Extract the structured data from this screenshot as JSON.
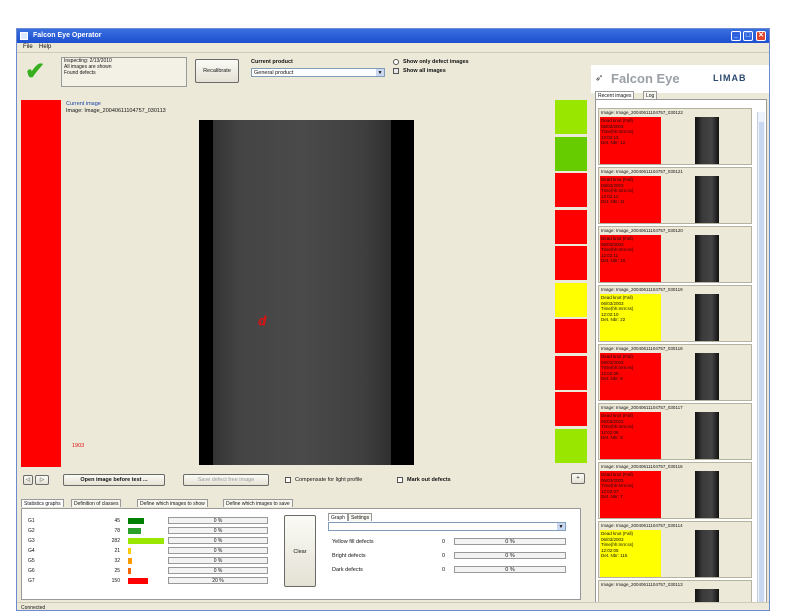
{
  "window": {
    "title": "Falcon Eye Operator"
  },
  "menu": [
    "File",
    "Help"
  ],
  "status": {
    "lines": [
      "Inspecting: 2/13/2010",
      "All images are shown",
      "Found defects"
    ]
  },
  "recalibrate_label": "Recalibrate",
  "current_product": {
    "label": "Current product",
    "value": "General product"
  },
  "view_options": [
    {
      "label": "Show only defect images",
      "selected": false
    },
    {
      "label": "Show all images",
      "selected": true
    }
  ],
  "logo": {
    "brand": "Falcon Eye",
    "company": "LIMAB"
  },
  "current_image": {
    "heading": "Current image",
    "name": "Image:   Image_20040611104757_030113",
    "counter": "1903"
  },
  "result_colors": [
    "#99e600",
    "#66cc00",
    "#ff0000",
    "#ff0000",
    "#ff0000",
    "#ffff00",
    "#ff0000",
    "#ff0000",
    "#ff0000",
    "#99e600"
  ],
  "controls": {
    "open_image_label": "Open image before test ...",
    "save_defect_label": "Save defect free image",
    "compensate_label": "Compensate for light profile",
    "mark_defects_label": "Mark out defects",
    "plus_label": "+"
  },
  "right_panel": {
    "tabs": [
      "Recent images",
      "Log"
    ],
    "thumbnails": [
      {
        "title": "Image:   Image_20040611104757_030122",
        "info": [
          "Dead knot (Fall)",
          "06/03/2003",
          "Time(hh:mm:ss)",
          "12:02:13",
          "Det. Nbr: 12"
        ],
        "color": "#ff0000"
      },
      {
        "title": "Image:   Image_20040611104757_030121",
        "info": [
          "Dead knot (Fall)",
          "06/03/2003",
          "Time(hh:mm:ss)",
          "12:02:12",
          "Det. Nbr: 11"
        ],
        "color": "#ff0000"
      },
      {
        "title": "Image:   Image_20040611104757_030120",
        "info": [
          "Dead knot (Fall)",
          "06/03/2003",
          "Time(hh:mm:ss)",
          "12:02:11",
          "Det. Nbr: 10"
        ],
        "color": "#ff0000"
      },
      {
        "title": "Image:   Image_20040611104757_030119",
        "info": [
          "Dead knot (Fall)",
          "06/03/2003",
          "Time(hh:mm:ss)",
          "12:02:10",
          "Det. Nbr: 22"
        ],
        "color": "#ffff00"
      },
      {
        "title": "Image:   Image_20040611104757_030118",
        "info": [
          "Dead knot (Fall)",
          "06/03/2003",
          "Time(hh:mm:ss)",
          "12:02:09",
          "Det. Nbr: 9"
        ],
        "color": "#ff0000"
      },
      {
        "title": "Image:   Image_20040611104757_030117",
        "info": [
          "Dead knot (Fall)",
          "06/03/2003",
          "Time(hh:mm:ss)",
          "12:02:08",
          "Det. Nbr: 8"
        ],
        "color": "#ff0000"
      },
      {
        "title": "Image:   Image_20040611104757_030116",
        "info": [
          "Dead knot (Fall)",
          "06/03/2003",
          "Time(hh:mm:ss)",
          "12:02:07",
          "Det. Nbr: 7"
        ],
        "color": "#ff0000"
      },
      {
        "title": "Image:   Image_20040611104757_030114",
        "info": [
          "Dead knot (Fall)",
          "06/03/2003",
          "Time(hh:mm:ss)",
          "12:02:05",
          "Det. Nbr: 115"
        ],
        "color": "#ffff00"
      },
      {
        "title": "Image:   Image_20040611104757_030113",
        "info": [],
        "color": "#ece9d8"
      }
    ]
  },
  "bottom": {
    "tabs": [
      "Statistics graphs",
      "Definition of classes",
      "Define which images to show",
      "Define which images to save"
    ],
    "graph_rows": [
      {
        "name": "G1",
        "count": 45,
        "pct_text": "0 %",
        "bar_color": "#008000",
        "frac": 0.45
      },
      {
        "name": "G2",
        "count": 78,
        "pct_text": "0 %",
        "bar_color": "#2aa02a",
        "frac": 0.35
      },
      {
        "name": "G3",
        "count": 282,
        "pct_text": "0 %",
        "bar_color": "#99e600",
        "frac": 1.0
      },
      {
        "name": "G4",
        "count": 21,
        "pct_text": "0 %",
        "bar_color": "#ffcc00",
        "frac": 0.08
      },
      {
        "name": "G5",
        "count": 32,
        "pct_text": "0 %",
        "bar_color": "#ff9900",
        "frac": 0.1
      },
      {
        "name": "G6",
        "count": 25,
        "pct_text": "0 %",
        "bar_color": "#ff6600",
        "frac": 0.09
      },
      {
        "name": "G7",
        "count": 150,
        "pct_text": "20 %",
        "bar_color": "#ff0000",
        "frac": 0.56
      }
    ],
    "clear_graphs_label": "Clear Graphs",
    "sub_tabs": [
      "Graph",
      "Settings"
    ],
    "graph_combo": "",
    "defect_rows": [
      {
        "label": "Yellow fill defects",
        "count": "0",
        "pct": "0 %"
      },
      {
        "label": "Bright defects",
        "count": "0",
        "pct": "0 %"
      },
      {
        "label": "Dark defects",
        "count": "0",
        "pct": "0 %"
      }
    ]
  },
  "statusbar": {
    "text": "Connected"
  }
}
